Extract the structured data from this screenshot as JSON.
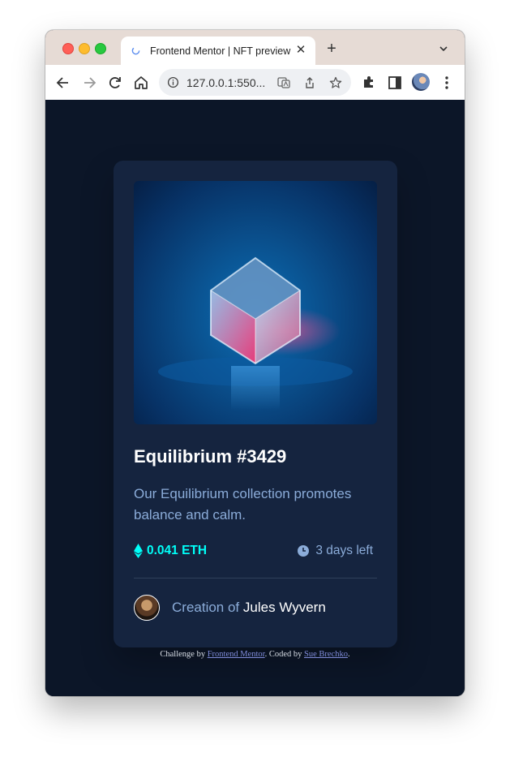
{
  "browser": {
    "tab_title": "Frontend Mentor | NFT preview card component",
    "url": "127.0.0.1:550...",
    "icons": [
      "back-icon",
      "forward-icon",
      "reload-icon",
      "home-icon",
      "info-icon",
      "translate-icon",
      "share-icon",
      "star-icon",
      "extensions-icon",
      "sidebar-icon",
      "profile-avatar",
      "menu-icon"
    ]
  },
  "card": {
    "title": "Equilibrium #3429",
    "description": "Our Equilibrium collection promotes balance and calm.",
    "price": "0.041 ETH",
    "time_left": "3 days left",
    "creator_prefix": "Creation of",
    "creator_name": "Jules Wyvern"
  },
  "footer": {
    "challenge_prefix": "Challenge by",
    "challenge_link": "Frontend Mentor",
    "coded_prefix": ". Coded by",
    "coded_link": "Sue Brechko",
    "suffix": "."
  },
  "colors": {
    "page_bg": "#0c1628",
    "card_bg": "#15243f",
    "accent_cyan": "#00fff8",
    "soft_blue": "#8bacd9",
    "white": "#ffffff"
  }
}
